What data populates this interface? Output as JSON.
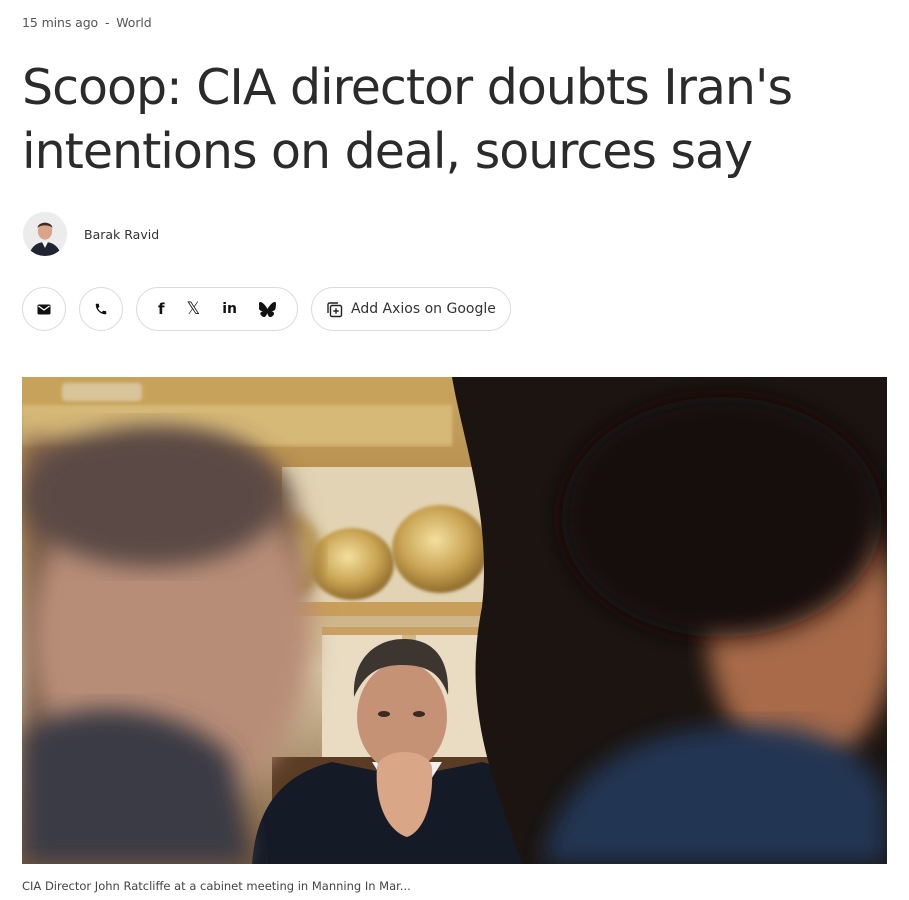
{
  "article": {
    "timestamp": "15 mins ago",
    "separator": "-",
    "section": "World",
    "headline": "Scoop: CIA director doubts Iran's intentions on deal, sources say",
    "author": "Barak Ravid",
    "caption": "CIA Director John Ratcliffe at a cabinet meeting in Manning In Mar..."
  },
  "share": {
    "email_icon": "mail-icon",
    "phone_icon": "phone-icon",
    "facebook_label": "f",
    "x_label": "𝕏",
    "linkedin_label": "in",
    "bluesky_icon": "butterfly-icon",
    "google_label": "Add Axios on Google"
  },
  "colors": {
    "text": "#2b2b2b",
    "muted": "#555555",
    "border": "#dadada"
  }
}
